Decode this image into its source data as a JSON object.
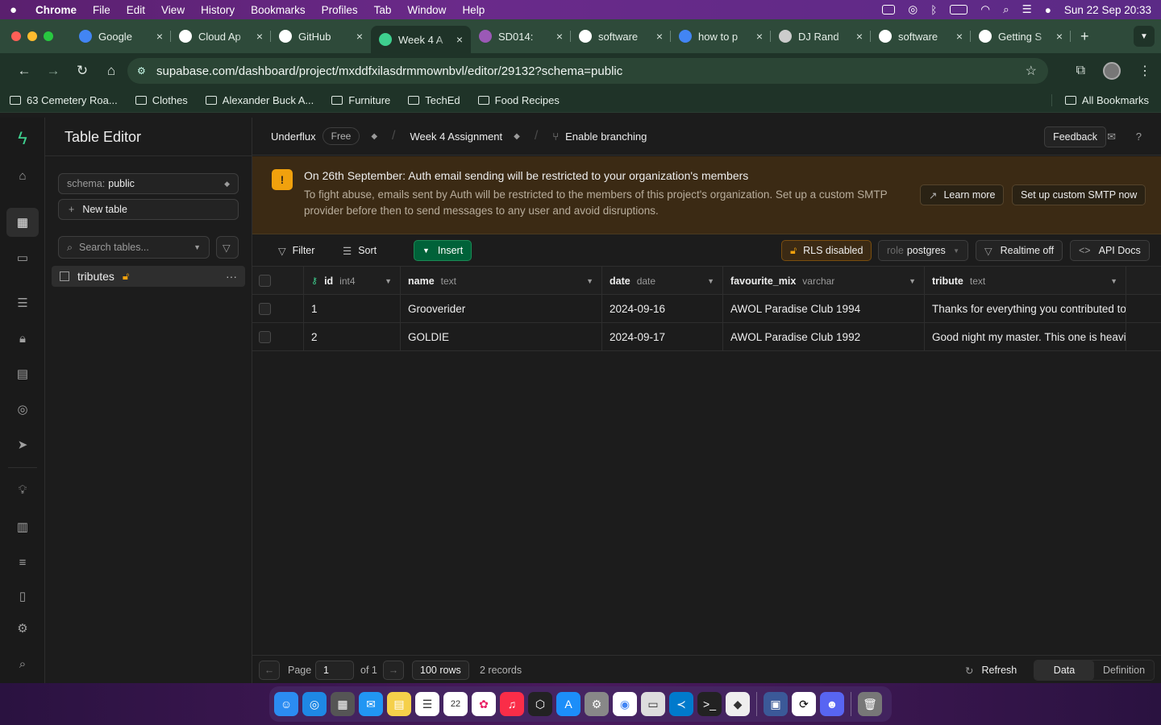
{
  "menubar": {
    "app": "Chrome",
    "items": [
      "File",
      "Edit",
      "View",
      "History",
      "Bookmarks",
      "Profiles",
      "Tab",
      "Window",
      "Help"
    ],
    "clock": "Sun 22 Sep  20:33"
  },
  "tabs": [
    {
      "title": "Google",
      "icon": "google-icon",
      "color": "#4285f4"
    },
    {
      "title": "Cloud Ap",
      "icon": "cloud-icon",
      "color": "#ffffff"
    },
    {
      "title": "GitHub",
      "icon": "github-icon",
      "color": "#ffffff"
    },
    {
      "title": "Week 4 A",
      "icon": "supabase-icon",
      "color": "#3ecf8e"
    },
    {
      "title": "SD014:",
      "icon": "app-icon",
      "color": "#9b59b6"
    },
    {
      "title": "software",
      "icon": "github-icon",
      "color": "#ffffff"
    },
    {
      "title": "how to p",
      "icon": "google-icon",
      "color": "#4285f4"
    },
    {
      "title": "DJ Rand",
      "icon": "globe-icon",
      "color": "#cccccc"
    },
    {
      "title": "software",
      "icon": "github-icon",
      "color": "#ffffff"
    },
    {
      "title": "Getting S",
      "icon": "medium-icon",
      "color": "#ffffff"
    }
  ],
  "address": {
    "url": "supabase.com/dashboard/project/mxddfxilasdrmmownbvl/editor/29132?schema=public"
  },
  "bookmarks": [
    "63 Cemetery Roa...",
    "Clothes",
    "Alexander Buck A...",
    "Furniture",
    "TechEd",
    "Food Recipes"
  ],
  "bookmarks_all": "All Bookmarks",
  "sidebar": {
    "title": "Table Editor",
    "schema_label": "schema:",
    "schema_value": "public",
    "new_table": "New table",
    "search_placeholder": "Search tables...",
    "table": "tributes"
  },
  "topnav": {
    "org": "Underflux",
    "plan": "Free",
    "project": "Week 4 Assignment",
    "branching": "Enable branching",
    "feedback": "Feedback"
  },
  "banner": {
    "title": "On 26th September: Auth email sending will be restricted to your organization's members",
    "desc": "To fight abuse, emails sent by Auth will be restricted to the members of this project's organization. Set up a custom SMTP provider before then to send messages to any user and avoid disruptions.",
    "learn": "Learn more",
    "smtp": "Set up custom SMTP now"
  },
  "toolbar": {
    "filter": "Filter",
    "sort": "Sort",
    "insert": "Insert",
    "rls": "RLS disabled",
    "role_label": "role",
    "role": "postgres",
    "realtime": "Realtime off",
    "api": "API Docs"
  },
  "columns": [
    {
      "name": "id",
      "type": "int4"
    },
    {
      "name": "name",
      "type": "text"
    },
    {
      "name": "date",
      "type": "date"
    },
    {
      "name": "favourite_mix",
      "type": "varchar"
    },
    {
      "name": "tribute",
      "type": "text"
    }
  ],
  "rows": [
    [
      "1",
      "Grooverider",
      "2024-09-16",
      "AWOL Paradise Club 1994",
      "Thanks for everything you contributed to"
    ],
    [
      "2",
      "GOLDIE",
      "2024-09-17",
      "AWOL Paradise Club 1992",
      "Good night my master. This one is heavier"
    ]
  ],
  "footer": {
    "page": "Page",
    "page_num": "1",
    "of": "of 1",
    "rows": "100 rows",
    "records": "2 records",
    "refresh": "Refresh",
    "data": "Data",
    "definition": "Definition"
  }
}
